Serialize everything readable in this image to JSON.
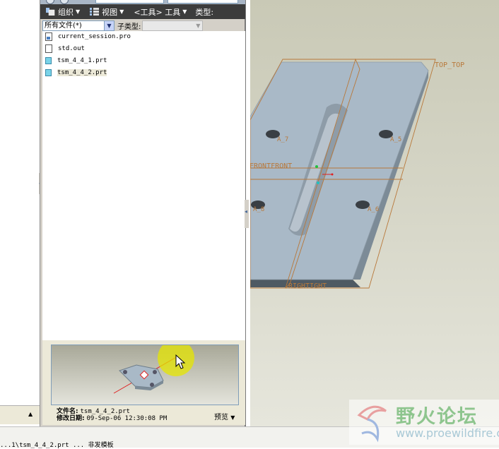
{
  "toolbar": {
    "organize_label": "组织",
    "view_label": "视图",
    "tools_label": "<工具> 工具",
    "type_label": "类型:"
  },
  "filter": {
    "type_value": "所有文件(*)",
    "subtype_label": "子类型:"
  },
  "files": [
    {
      "name": "current_session.pro",
      "icon": "pro-file-icon"
    },
    {
      "name": "std.out",
      "icon": "text-file-icon"
    },
    {
      "name": "tsm_4_4_1.prt",
      "icon": "part-file-icon"
    },
    {
      "name": "tsm_4_4_2.prt",
      "icon": "part-file-icon"
    }
  ],
  "preview": {
    "filename_label": "文件名:",
    "filename_value": "tsm_4_4_2.prt",
    "modified_label": "修改日期:",
    "modified_value": "09-Sep-06 12:30:08 PM",
    "preview_button": "预览"
  },
  "viewport": {
    "labels": {
      "top": "TOP_TOP",
      "front": "FRONTFRONT",
      "right": "RIGHTIGHT",
      "a5": "A_5",
      "a6": "A_6",
      "a7": "A_7",
      "a8": "A_8"
    }
  },
  "message": "...1\\tsm_4_4_2.prt ... 非发模板",
  "watermark": {
    "name": "野火论坛",
    "url": "www.proewildfire.cn"
  },
  "colors": {
    "toolbar_bg": "#3c3c3c",
    "part_face": "#a9b9c7",
    "part_side": "#7c8b97",
    "datum_plane": "#b8783a",
    "viewport_bg": "#d2d2c2"
  }
}
